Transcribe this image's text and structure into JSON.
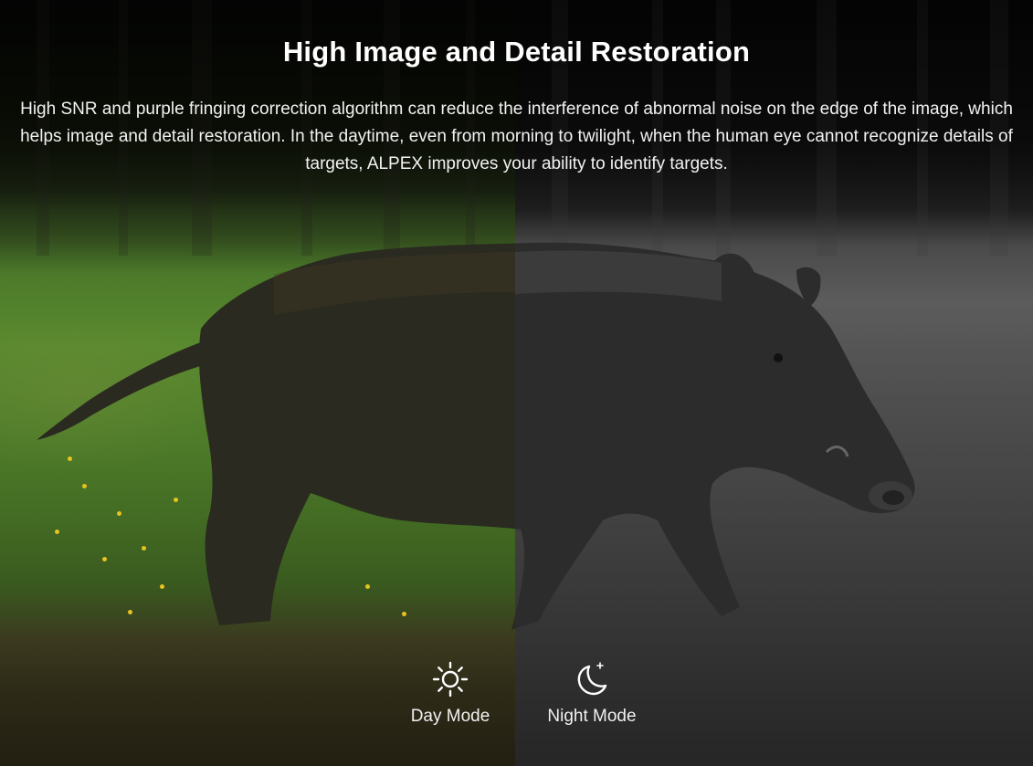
{
  "header": {
    "title": "High Image and Detail Restoration",
    "description": "High SNR and purple fringing correction algorithm can reduce the interference of abnormal noise on the edge of the image, which helps image and detail restoration. In the daytime, even from morning to twilight, when the human eye cannot recognize details of targets, ALPEX improves your ability to identify targets."
  },
  "modes": {
    "day": {
      "label": "Day Mode",
      "icon": "sun-icon"
    },
    "night": {
      "label": "Night Mode",
      "icon": "moon-icon"
    }
  },
  "colors": {
    "text": "#ffffff",
    "day_grass": "#5a8a2f",
    "night_grass": "#5c5c5c"
  }
}
